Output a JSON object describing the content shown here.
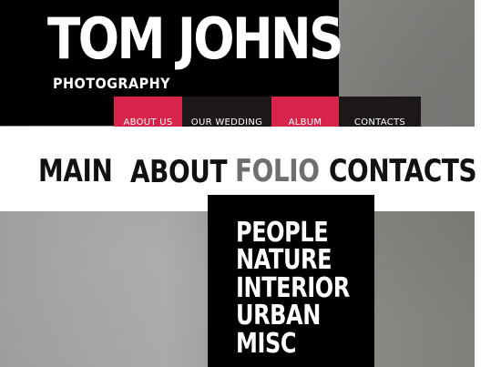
{
  "header": {
    "title": "TOM JOHNS",
    "subtitle": "PHOTOGRAPHY"
  },
  "top_nav": {
    "items": [
      {
        "label": "ABOUT US",
        "color": "#d8244a"
      },
      {
        "label": "OUR WEDDING",
        "color": "#1c1718"
      },
      {
        "label": "ALBUM",
        "color": "#d8244a"
      },
      {
        "label": "CONTACTS",
        "color": "#1c1718"
      }
    ]
  },
  "main_nav": {
    "items": [
      {
        "label": "MAIN",
        "state": "normal"
      },
      {
        "label": "ABOUT",
        "state": "normal"
      },
      {
        "label": "FOLIO",
        "state": "active"
      },
      {
        "label": "CONTACTS",
        "state": "normal"
      }
    ]
  },
  "folio_menu": {
    "items": [
      "PEOPLE",
      "NATURE",
      "INTERIOR",
      "URBAN",
      "MISC"
    ]
  },
  "colors": {
    "accent": "#d8244a",
    "dark": "#1c1718",
    "active_text": "#6e6e6e",
    "normal_text": "#111111"
  }
}
